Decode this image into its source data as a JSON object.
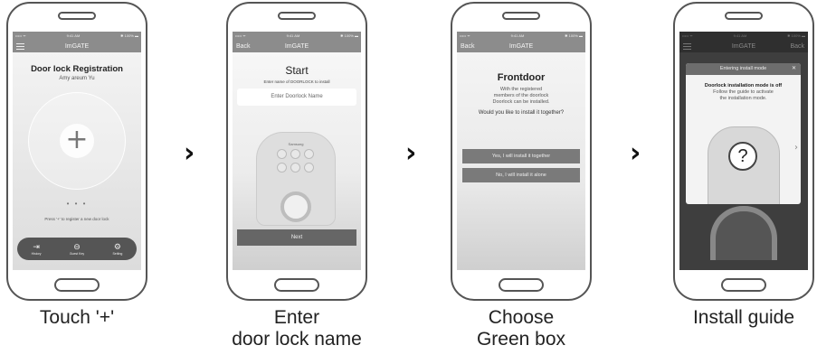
{
  "status": {
    "left": "••••• ᯤ",
    "time": "9:41 AM",
    "right": "✱ 100% ▬"
  },
  "app_title": "ImGATE",
  "back_label": "Back",
  "arrow": "›",
  "screen1": {
    "title": "Door lock Registration",
    "subtitle": "Amy areum Yu",
    "plus": "+",
    "dots": "• • •",
    "hint": "Press '+' to register a new door lock",
    "tabs": [
      {
        "icon": "⇥",
        "label": "History"
      },
      {
        "icon": "⊖",
        "label": "Guest Key"
      },
      {
        "icon": "⚙",
        "label": "Setting"
      }
    ]
  },
  "screen2": {
    "title": "Start",
    "subtitle": "Enter name of DOORLOCK to install",
    "input_placeholder": "Enter Doorlock Name",
    "brand": "Samsung",
    "next": "Next"
  },
  "screen3": {
    "title": "Frontdoor",
    "desc1": "With the registered",
    "desc2": "members of the doorlock",
    "desc3": "Doorlock can be installed.",
    "question": "Would you like to install it together?",
    "yes": "Yes, I will install it together",
    "no": "No, I will install it alone"
  },
  "screen4": {
    "nav_right": "Back",
    "dialog_title": "Entering install mode",
    "close": "✕",
    "bold": "Doorlock installation mode is off",
    "line1": "Follow the guide to activate",
    "line2": "the installation mode.",
    "qmark": "?",
    "arrow": "›"
  },
  "captions": {
    "c1": "Touch '+'",
    "c2a": "Enter",
    "c2b": "door lock name",
    "c3a": "Choose",
    "c3b": "Green box",
    "c4": "Install guide"
  }
}
